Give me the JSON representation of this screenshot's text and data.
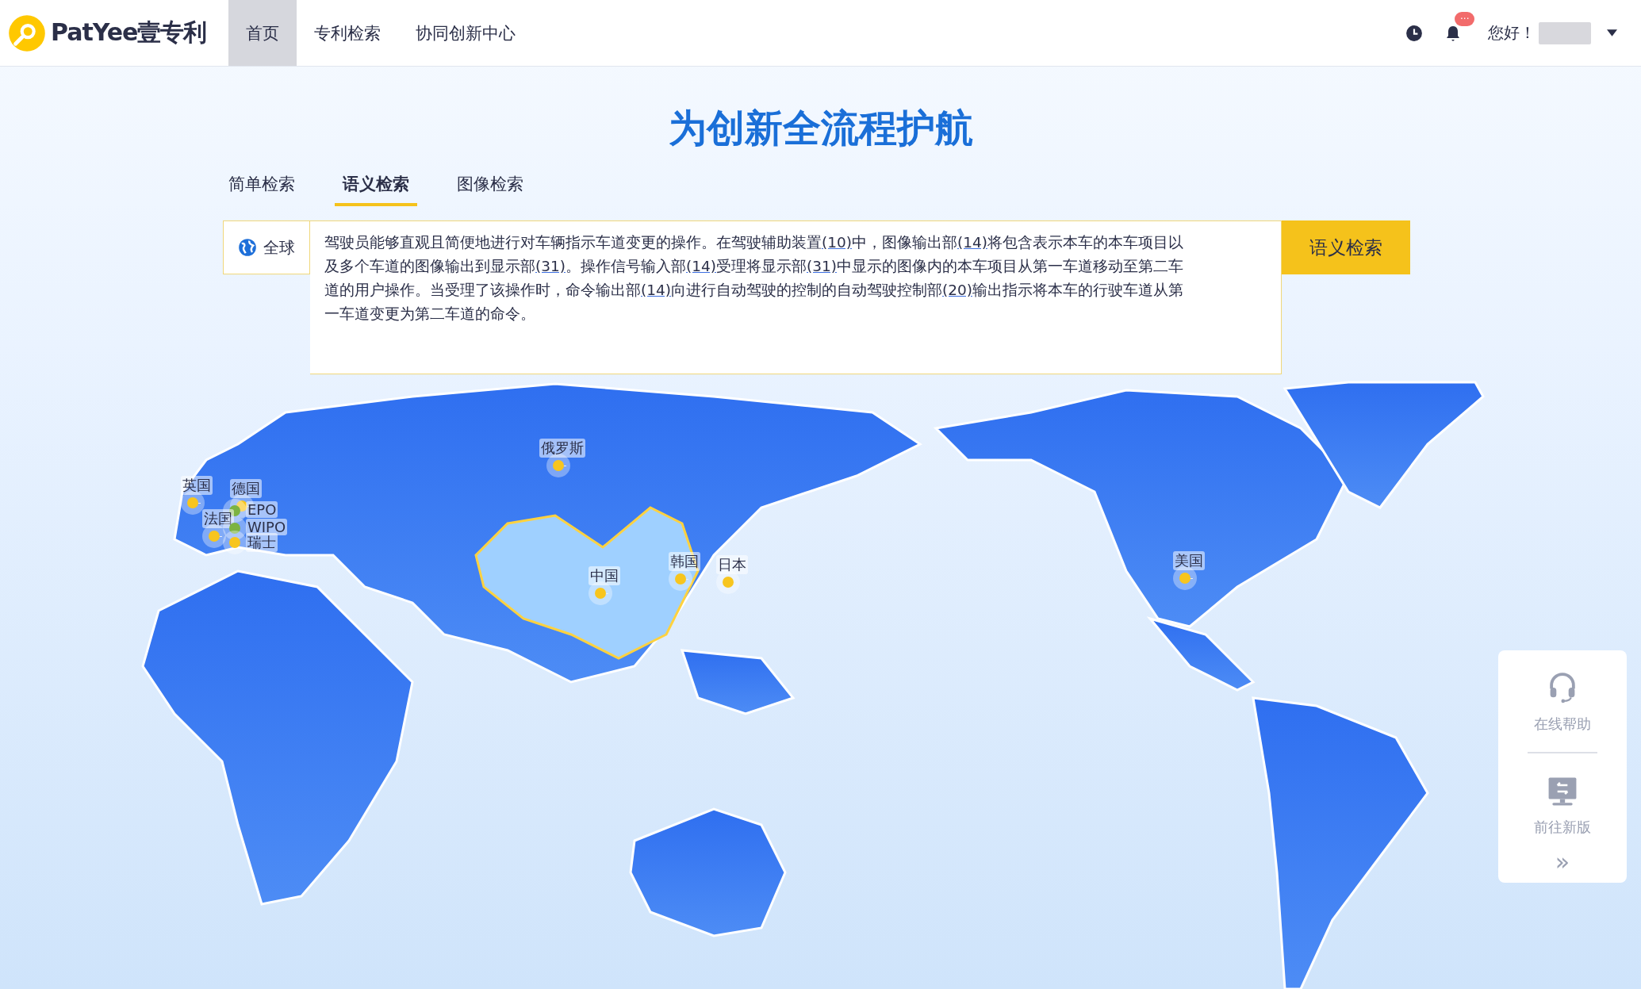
{
  "header": {
    "logo_text": "PatYee壹专利",
    "nav": [
      {
        "label": "首页",
        "selected": true
      },
      {
        "label": "专利检索",
        "selected": false
      },
      {
        "label": "协同创新中心",
        "selected": false
      }
    ],
    "notification_badge": "···",
    "greeting": "您好！"
  },
  "hero": {
    "title": "为创新全流程护航"
  },
  "search_tabs": [
    {
      "label": "简单检索",
      "selected": false
    },
    {
      "label": "语义检索",
      "selected": true
    },
    {
      "label": "图像检索",
      "selected": false
    }
  ],
  "search": {
    "scope": "全球",
    "query": [
      {
        "text": "驾驶员能够直观且简便地进行对车辆指示车道变更的操作。在驾驶辅助装置",
        "underlined": false
      },
      {
        "text": "(10)",
        "underlined": true
      },
      {
        "text": "中，图像输出部",
        "underlined": false
      },
      {
        "text": "(14)",
        "underlined": true
      },
      {
        "text": "将包含表示本车的本车项目以及多个车道的图像输出到显示部",
        "underlined": false
      },
      {
        "text": "(31)",
        "underlined": true
      },
      {
        "text": "。操作信号输入部",
        "underlined": false
      },
      {
        "text": "(14)",
        "underlined": true
      },
      {
        "text": "受理将显示部",
        "underlined": false
      },
      {
        "text": "(31)",
        "underlined": true
      },
      {
        "text": "中显示的图像内的本车项目从第一车道移动至第二车道的用户操作。当受理了该操作时，命令输出部",
        "underlined": false
      },
      {
        "text": "(14)",
        "underlined": true
      },
      {
        "text": "向进行自动驾驶的控制的自动驾驶控制部",
        "underlined": false
      },
      {
        "text": "(20)",
        "underlined": true
      },
      {
        "text": "输出指示将本车的行驶车道从第一车道变更为第二车道的命令。",
        "underlined": false
      }
    ],
    "button": "语义检索"
  },
  "map_markers": [
    {
      "label": "俄罗斯",
      "color": "#f7c51e"
    },
    {
      "label": "英国",
      "color": "#f7c51e"
    },
    {
      "label": "德国",
      "color": "#f7c51e"
    },
    {
      "label": "EPO",
      "color": "#7cb342"
    },
    {
      "label": "法国",
      "color": "#f7c51e"
    },
    {
      "label": "WIPO",
      "color": "#7cb342"
    },
    {
      "label": "瑞士",
      "color": "#f7c51e"
    },
    {
      "label": "中国",
      "color": "#f7c51e"
    },
    {
      "label": "韩国",
      "color": "#f7c51e"
    },
    {
      "label": "日本",
      "color": "#f7c51e"
    },
    {
      "label": "美国",
      "color": "#f7c51e"
    }
  ],
  "side_panel": {
    "items": [
      {
        "kind": "help",
        "label": "在线帮助"
      },
      {
        "kind": "new_version",
        "label": "前往新版"
      }
    ],
    "collapse": "»"
  }
}
